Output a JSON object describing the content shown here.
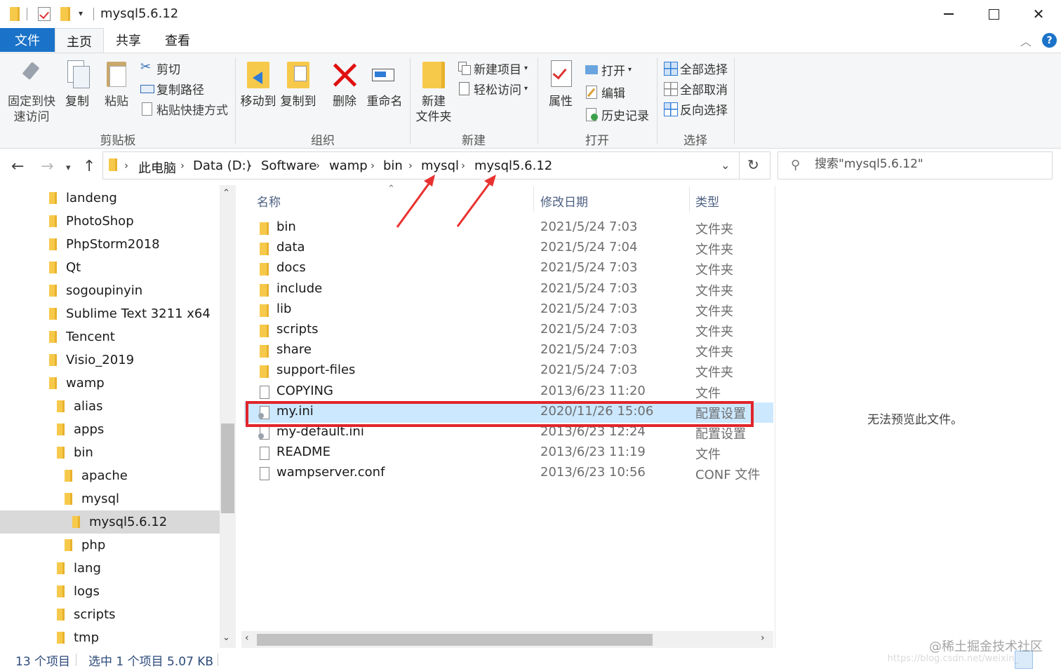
{
  "window": {
    "title": "mysql5.6.12"
  },
  "ribbon_tabs": [
    "文件",
    "主页",
    "共享",
    "查看"
  ],
  "ribbon": {
    "clipboard": {
      "pin": [
        "固定到快",
        "速访问"
      ],
      "copy": "复制",
      "paste": "粘贴",
      "cut": "剪切",
      "copy_path": "复制路径",
      "paste_shortcut": "粘贴快捷方式",
      "label": "剪贴板"
    },
    "organize": {
      "move_to": "移动到",
      "copy_to": "复制到",
      "delete": "删除",
      "rename": "重命名",
      "label": "组织"
    },
    "new": {
      "new_folder": [
        "新建",
        "文件夹"
      ],
      "new_item": "新建项目",
      "easy_access": "轻松访问",
      "label": "新建"
    },
    "open": {
      "properties": "属性",
      "open": "打开",
      "edit": "编辑",
      "history": "历史记录",
      "label": "打开"
    },
    "select": {
      "select_all": "全部选择",
      "select_none": "全部取消",
      "invert": "反向选择",
      "label": "选择"
    }
  },
  "address": {
    "crumbs": [
      "此电脑",
      "Data (D:)",
      "Software",
      "wamp",
      "bin",
      "mysql",
      "mysql5.6.12"
    ]
  },
  "search": {
    "placeholder": "搜索\"mysql5.6.12\""
  },
  "tree": [
    {
      "label": "landeng",
      "level": 0
    },
    {
      "label": "PhotoShop",
      "level": 0
    },
    {
      "label": "PhpStorm2018",
      "level": 0
    },
    {
      "label": "Qt",
      "level": 0
    },
    {
      "label": "sogoupinyin",
      "level": 0
    },
    {
      "label": "Sublime Text 3211 x64",
      "level": 0
    },
    {
      "label": "Tencent",
      "level": 0
    },
    {
      "label": "Visio_2019",
      "level": 0
    },
    {
      "label": "wamp",
      "level": 0
    },
    {
      "label": "alias",
      "level": 1
    },
    {
      "label": "apps",
      "level": 1
    },
    {
      "label": "bin",
      "level": 1
    },
    {
      "label": "apache",
      "level": 2
    },
    {
      "label": "mysql",
      "level": 2
    },
    {
      "label": "mysql5.6.12",
      "level": 3,
      "selected": true
    },
    {
      "label": "php",
      "level": 2
    },
    {
      "label": "lang",
      "level": 1
    },
    {
      "label": "logs",
      "level": 1
    },
    {
      "label": "scripts",
      "level": 1
    },
    {
      "label": "tmp",
      "level": 1
    }
  ],
  "columns": {
    "name": "名称",
    "date": "修改日期",
    "type": "类型"
  },
  "files": [
    {
      "name": "bin",
      "date": "2021/5/24 7:03",
      "type": "文件夹",
      "kind": "folder"
    },
    {
      "name": "data",
      "date": "2021/5/24 7:04",
      "type": "文件夹",
      "kind": "folder"
    },
    {
      "name": "docs",
      "date": "2021/5/24 7:03",
      "type": "文件夹",
      "kind": "folder"
    },
    {
      "name": "include",
      "date": "2021/5/24 7:03",
      "type": "文件夹",
      "kind": "folder"
    },
    {
      "name": "lib",
      "date": "2021/5/24 7:03",
      "type": "文件夹",
      "kind": "folder"
    },
    {
      "name": "scripts",
      "date": "2021/5/24 7:03",
      "type": "文件夹",
      "kind": "folder"
    },
    {
      "name": "share",
      "date": "2021/5/24 7:03",
      "type": "文件夹",
      "kind": "folder"
    },
    {
      "name": "support-files",
      "date": "2021/5/24 7:03",
      "type": "文件夹",
      "kind": "folder"
    },
    {
      "name": "COPYING",
      "date": "2013/6/23 11:20",
      "type": "文件",
      "kind": "file"
    },
    {
      "name": "my.ini",
      "date": "2020/11/26 15:06",
      "type": "配置设置",
      "kind": "ini",
      "selected": true
    },
    {
      "name": "my-default.ini",
      "date": "2013/6/23 12:24",
      "type": "配置设置",
      "kind": "ini"
    },
    {
      "name": "README",
      "date": "2013/6/23 11:19",
      "type": "文件",
      "kind": "file"
    },
    {
      "name": "wampserver.conf",
      "date": "2013/6/23 10:56",
      "type": "CONF 文件",
      "kind": "file"
    }
  ],
  "preview": {
    "message": "无法预览此文件。"
  },
  "status": {
    "count": "13 个项目",
    "selection": "选中 1 个项目  5.07 KB"
  },
  "watermark": {
    "main": "@稀土掘金技术社区",
    "sub": "https://blog.csdn.net/weixin_"
  },
  "annotations": {
    "arrow_color": "#e8322f",
    "highlight_color": "#e0262c"
  }
}
